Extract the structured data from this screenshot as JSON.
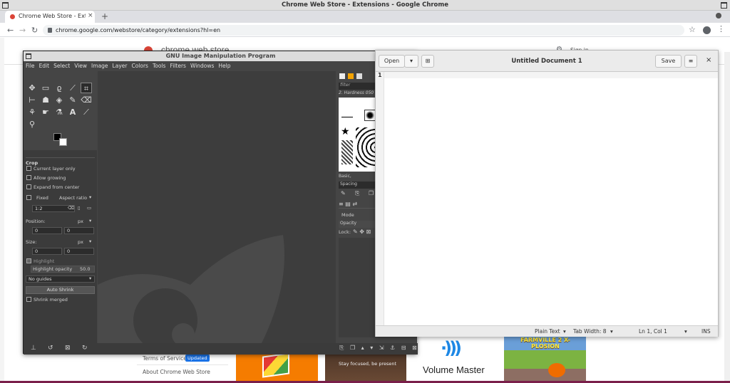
{
  "chrome": {
    "window_title": "Chrome Web Store - Extensions - Google Chrome",
    "tab_label": "Chrome Web Store - Extension",
    "new_tab": "+",
    "url": "chrome.google.com/webstore/category/extensions?hl=en"
  },
  "webstore": {
    "brand": "chrome web store",
    "sign_in": "Sign in",
    "footer_terms": "Terms of Service",
    "footer_badge": "Updated",
    "footer_about": "About Chrome Web Store",
    "card_focus_text": "Stay focused, be present",
    "card_volume_title": "Volume Master",
    "card_game_title": "FARMVILLE 2 X-PLOSION"
  },
  "gimp": {
    "title": "GNU Image Manipulation Program",
    "menu": [
      "File",
      "Edit",
      "Select",
      "View",
      "Image",
      "Layer",
      "Colors",
      "Tools",
      "Filters",
      "Windows",
      "Help"
    ],
    "tool_options": {
      "heading": "Crop",
      "current_layer_only": "Current layer only",
      "allow_growing": "Allow growing",
      "expand_from_center": "Expand from center",
      "fixed": "Fixed",
      "aspect_ratio": "Aspect ratio",
      "ratio_value": "1:2",
      "position_label": "Position:",
      "position_unit": "px",
      "pos_x": "0",
      "pos_y": "0",
      "size_label": "Size:",
      "size_unit": "px",
      "size_w": "0",
      "size_h": "0",
      "highlight": "Highlight",
      "highlight_opacity_label": "Highlight opacity",
      "highlight_opacity_value": "50.0",
      "guides": "No guides",
      "auto_shrink": "Auto Shrink",
      "shrink_merged": "Shrink merged"
    },
    "brushes": {
      "filter_placeholder": "filter",
      "current_brush": "2. Hardness 050",
      "preset": "Basic,",
      "spacing": "Spacing"
    },
    "layers": {
      "mode": "Mode",
      "opacity": "Opacity",
      "lock": "Lock:"
    }
  },
  "gedit": {
    "open_label": "Open",
    "doc_title": "Untitled Document 1",
    "save_label": "Save",
    "line_number": "1",
    "status": {
      "language": "Plain Text",
      "tab_width": "Tab Width: 8",
      "position": "Ln 1, Col 1",
      "mode": "INS"
    }
  }
}
